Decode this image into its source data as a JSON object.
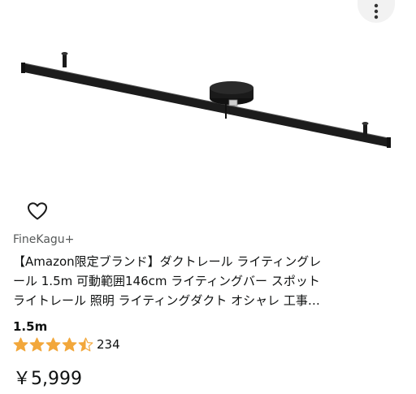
{
  "product": {
    "image_alt": "ダクトレール ライティングレール 1.5m",
    "brand": "FineKagu+",
    "title_lines": [
      "【Amazon限定ブランド】ダクトレール ライティングレ",
      "ール 1.5m 可動範囲146cm ライティングバー スポット",
      "ライトレール 照明 ライティングダクト オシャレ 工事…"
    ],
    "size": "1.5m",
    "rating_value": 4.5,
    "review_count": "234",
    "price": "￥5,999"
  },
  "icons": {
    "more": "more-vertical-icon",
    "favorite": "heart-outline-icon",
    "star": "star-icon"
  },
  "colors": {
    "star": "#f2a73b",
    "text": "#0f1111",
    "muted": "#565959",
    "rail": "#1a1a1a"
  }
}
